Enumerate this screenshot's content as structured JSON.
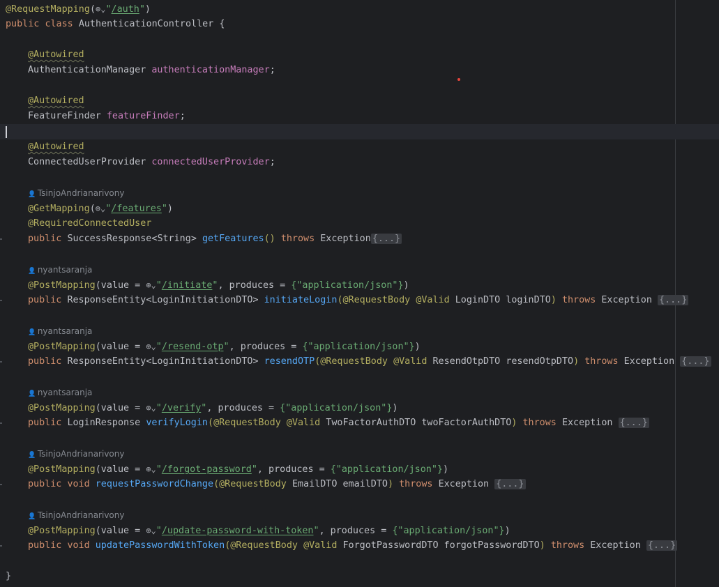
{
  "code": {
    "class_mapping": {
      "annotation": "@RequestMapping",
      "path": "/auth"
    },
    "class_decl": {
      "public": "public",
      "class": "class",
      "name": "AuthenticationController",
      "brace": "{"
    },
    "autowired": "@Autowired",
    "fields": [
      {
        "type": "AuthenticationManager",
        "name": "authenticationManager"
      },
      {
        "type": "FeatureFinder",
        "name": "featureFinder"
      },
      {
        "type": "ConnectedUserProvider",
        "name": "connectedUserProvider"
      }
    ],
    "globe_icon": "globe-icon",
    "authors": [
      "TsinjoAndrianarivony",
      "nyantsaranja",
      "nyantsaranja",
      "nyantsaranja",
      "TsinjoAndrianarivony",
      "TsinjoAndrianarivony"
    ],
    "get_features": {
      "annotation": "@GetMapping",
      "path": "/features",
      "extra_annotation": "@RequiredConnectedUser",
      "public": "public",
      "return_type": "SuccessResponse",
      "generic": "String",
      "method": "getFeatures",
      "params": "()",
      "throws": "throws",
      "exception": "Exception",
      "fold": "{...}"
    },
    "post_common": {
      "annotation": "@PostMapping",
      "value_prefix": "(value = ",
      "produces": ", produces = ",
      "produces_value": "{\"application/json\"}",
      "close": ")",
      "public": "public",
      "void": "void",
      "request_body": "@RequestBody",
      "valid": "@Valid",
      "throws": "throws",
      "exception": "Exception",
      "fold": "{...}"
    },
    "initiate": {
      "path": "/initiate",
      "return_type": "ResponseEntity",
      "generic": "LoginInitiationDTO",
      "method": "initiateLogin",
      "param_type": "LoginDTO",
      "param_name": "loginDTO"
    },
    "resend": {
      "path": "/resend-otp",
      "return_type": "ResponseEntity",
      "generic": "LoginInitiationDTO",
      "method": "resendOTP",
      "param_type": "ResendOtpDTO",
      "param_name": "resendOtpDTO"
    },
    "verify": {
      "path": "/verify",
      "return_type": "LoginResponse",
      "method": "verifyLogin",
      "param_type": "TwoFactorAuthDTO",
      "param_name": "twoFactorAuthDTO"
    },
    "forgot": {
      "path": "/forgot-password",
      "method": "requestPasswordChange",
      "param_type": "EmailDTO",
      "param_name": "emailDTO"
    },
    "update": {
      "path": "/update-password-with-token",
      "method": "updatePasswordWithToken",
      "param_type": "ForgotPasswordDTO",
      "param_name": "forgotPasswordDTO"
    },
    "closing_brace": "}"
  }
}
